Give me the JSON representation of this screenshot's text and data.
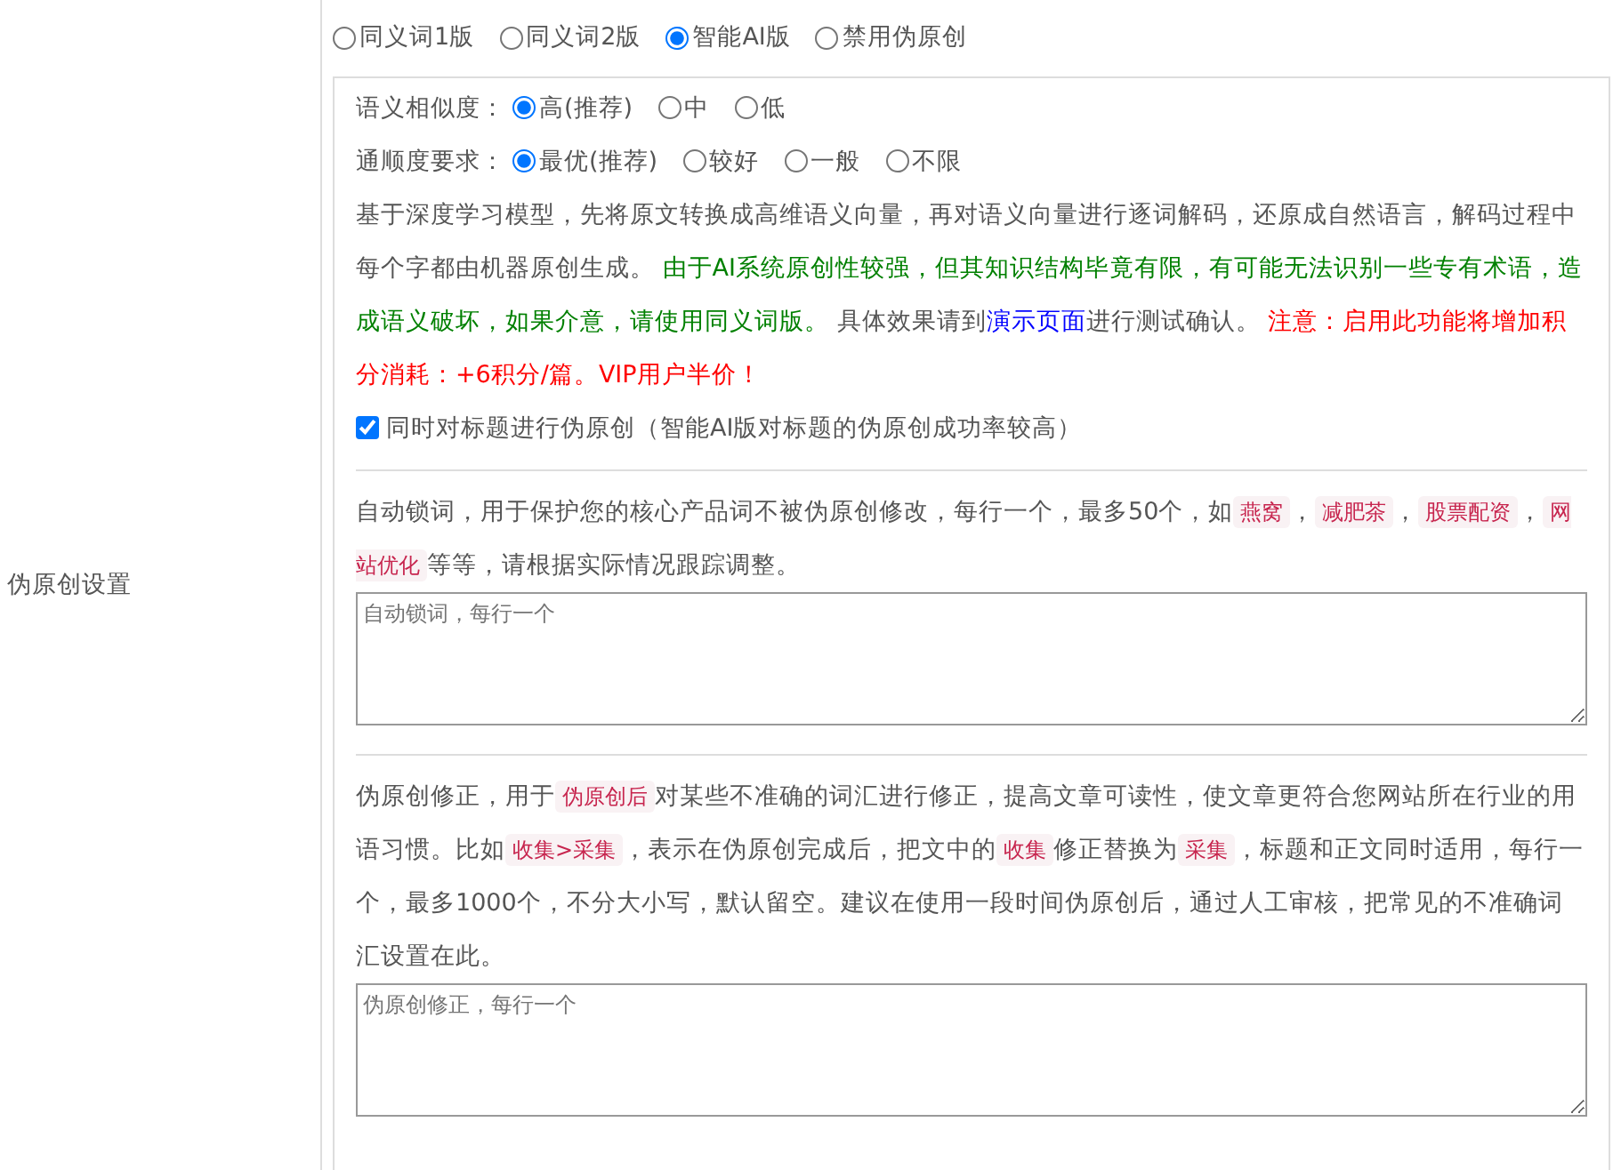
{
  "setting_label": "伪原创设置",
  "modes": [
    {
      "label": "同义词1版",
      "selected": false
    },
    {
      "label": "同义词2版",
      "selected": false
    },
    {
      "label": "智能AI版",
      "selected": true
    },
    {
      "label": "禁用伪原创",
      "selected": false
    }
  ],
  "similarity": {
    "label": "语义相似度：",
    "options": [
      {
        "label": "高(推荐)",
        "selected": true
      },
      {
        "label": "中",
        "selected": false
      },
      {
        "label": "低",
        "selected": false
      }
    ]
  },
  "fluency": {
    "label": "通顺度要求：",
    "options": [
      {
        "label": "最优(推荐)",
        "selected": true
      },
      {
        "label": "较好",
        "selected": false
      },
      {
        "label": "一般",
        "selected": false
      },
      {
        "label": "不限",
        "selected": false
      }
    ]
  },
  "ai_description": [
    {
      "kind": "text",
      "text": "基于深度学习模型，先将原文转换成高维语义向量，再对语义向量进行逐词解码，还原成自然语言，解码过程中每个字都由机器原创生成。 "
    },
    {
      "kind": "green",
      "text": "由于AI系统原创性较强，但其知识结构毕竟有限，有可能无法识别一些专有术语，造成语义破坏，如果介意，请使用同义词版。"
    },
    {
      "kind": "text",
      "text": " 具体效果请到"
    },
    {
      "kind": "link",
      "text": "演示页面"
    },
    {
      "kind": "text",
      "text": "进行测试确认。 "
    },
    {
      "kind": "red",
      "text": "注意：启用此功能将增加积分消耗：+6积分/篇。VIP用户半价！"
    }
  ],
  "title_option": {
    "label": "同时对标题进行伪原创（智能AI版对标题的伪原创成功率较高）",
    "checked": true
  },
  "lock_words": {
    "description": [
      {
        "kind": "text",
        "text": "自动锁词，用于保护您的核心产品词不被伪原创修改，每行一个，最多50个，如"
      },
      {
        "kind": "code",
        "text": "燕窝"
      },
      {
        "kind": "text",
        "text": "，"
      },
      {
        "kind": "code",
        "text": "减肥茶"
      },
      {
        "kind": "text",
        "text": "，"
      },
      {
        "kind": "code",
        "text": "股票配资"
      },
      {
        "kind": "text",
        "text": "，"
      },
      {
        "kind": "code",
        "text": "网站优化"
      },
      {
        "kind": "text",
        "text": "等等，请根据实际情况跟踪调整。"
      }
    ],
    "placeholder": "自动锁词，每行一个"
  },
  "corrections": {
    "description": [
      {
        "kind": "text",
        "text": "伪原创修正，用于"
      },
      {
        "kind": "code",
        "text": "伪原创后"
      },
      {
        "kind": "text",
        "text": "对某些不准确的词汇进行修正，提高文章可读性，使文章更符合您网站所在行业的用语习惯。比如"
      },
      {
        "kind": "code",
        "text": "收集>采集"
      },
      {
        "kind": "text",
        "text": "，表示在伪原创完成后，把文中的"
      },
      {
        "kind": "code",
        "text": "收集"
      },
      {
        "kind": "text",
        "text": "修正替换为"
      },
      {
        "kind": "code",
        "text": "采集"
      },
      {
        "kind": "text",
        "text": "，标题和正文同时适用，每行一个，最多1000个，不分大小写，默认留空。建议在使用一段时间伪原创后，通过人工审核，把常见的不准确词汇设置在此。"
      }
    ],
    "placeholder": "伪原创修正，每行一个"
  }
}
